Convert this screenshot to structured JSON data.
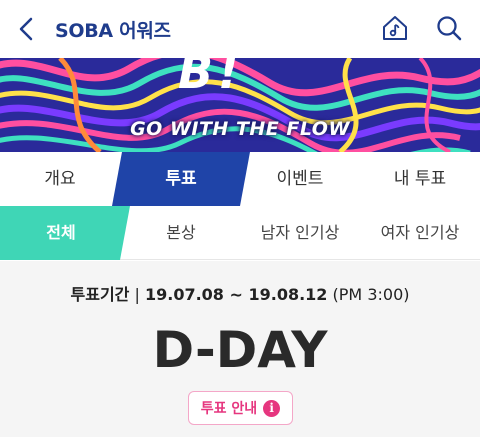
{
  "header": {
    "title": "SOBA 어워즈",
    "back_icon": "chevron-left-icon",
    "home_icon": "music-home-icon",
    "search_icon": "search-icon",
    "title_color": "#1f3c8c"
  },
  "banner": {
    "slogan": "GO WITH THE FLOW",
    "logo_text": "B"
  },
  "main_tabs": [
    {
      "label": "개요",
      "active": false
    },
    {
      "label": "투표",
      "active": true
    },
    {
      "label": "이벤트",
      "active": false
    },
    {
      "label": "내 투표",
      "active": false
    }
  ],
  "sub_tabs": [
    {
      "label": "전체",
      "active": true
    },
    {
      "label": "본상",
      "active": false
    },
    {
      "label": "남자 인기상",
      "active": false
    },
    {
      "label": "여자 인기상",
      "active": false
    }
  ],
  "vote": {
    "period_label": "투표기간",
    "period_value": "19.07.08 ~ 19.08.12",
    "period_time": "(PM 3:00)",
    "dday_text": "D-DAY",
    "guide_label": "투표 안내",
    "info_icon": "info-icon"
  },
  "colors": {
    "main_tab_active": "#1f44a8",
    "sub_tab_active": "#3fd6b6",
    "accent_pink": "#e6367f"
  }
}
